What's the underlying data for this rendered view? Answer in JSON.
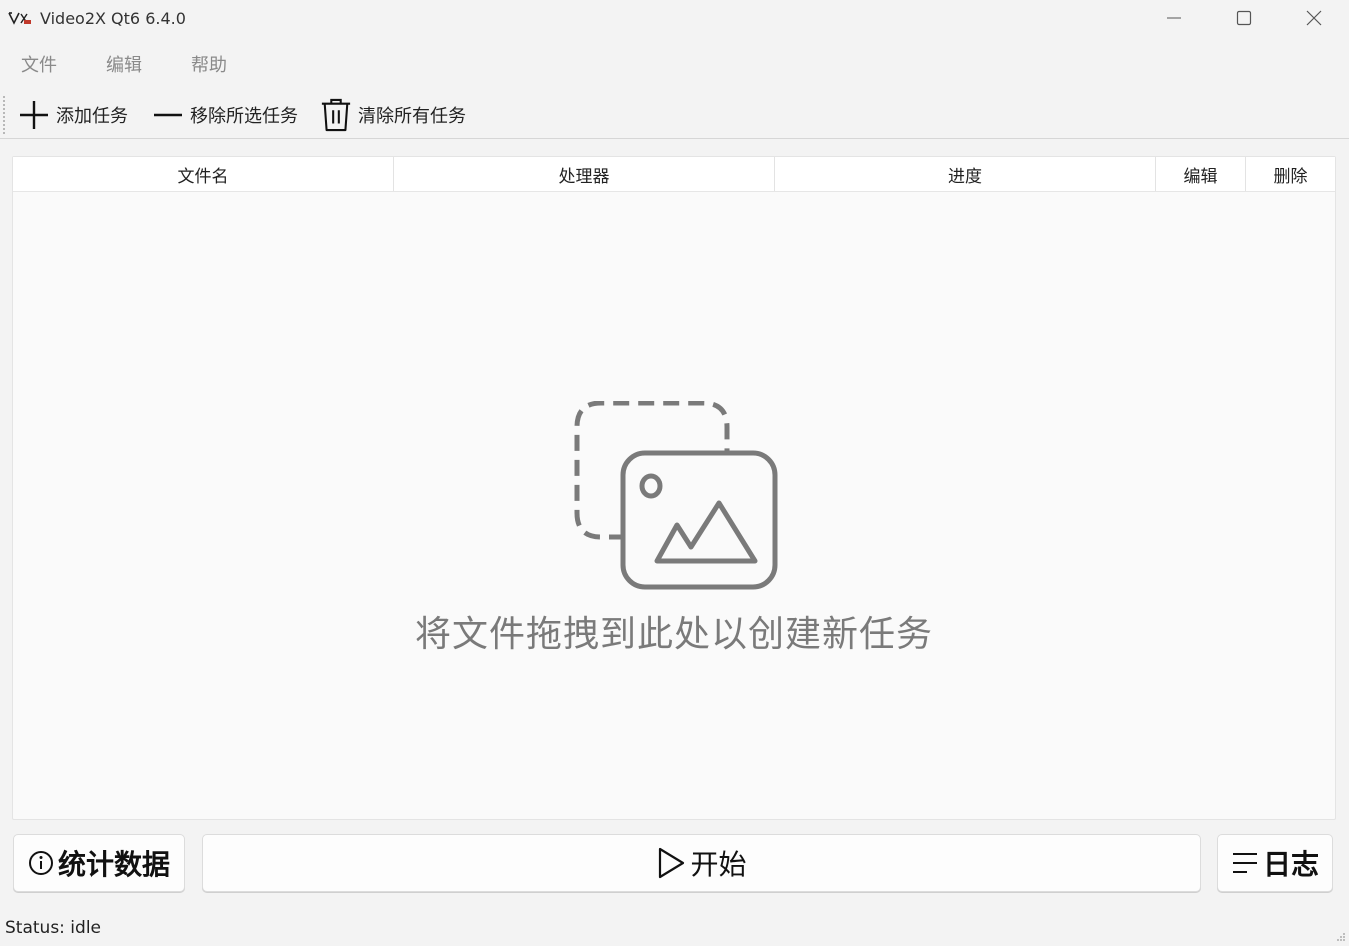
{
  "window": {
    "title": "Video2X Qt6 6.4.0",
    "logo_icon": "video2x-logo-icon"
  },
  "menu": {
    "items": [
      {
        "label": "文件"
      },
      {
        "label": "编辑"
      },
      {
        "label": "帮助"
      }
    ]
  },
  "toolbar": {
    "add_label": "添加任务",
    "remove_label": "移除所选任务",
    "clear_label": "清除所有任务"
  },
  "table": {
    "columns": [
      "文件名",
      "处理器",
      "进度",
      "编辑",
      "删除"
    ],
    "rows": []
  },
  "empty_state": {
    "message": "将文件拖拽到此处以创建新任务",
    "icon": "image-drop-icon"
  },
  "buttons": {
    "stats_label": "统计数据",
    "start_label": "开始",
    "log_label": "日志"
  },
  "status": {
    "text": "Status: idle"
  }
}
